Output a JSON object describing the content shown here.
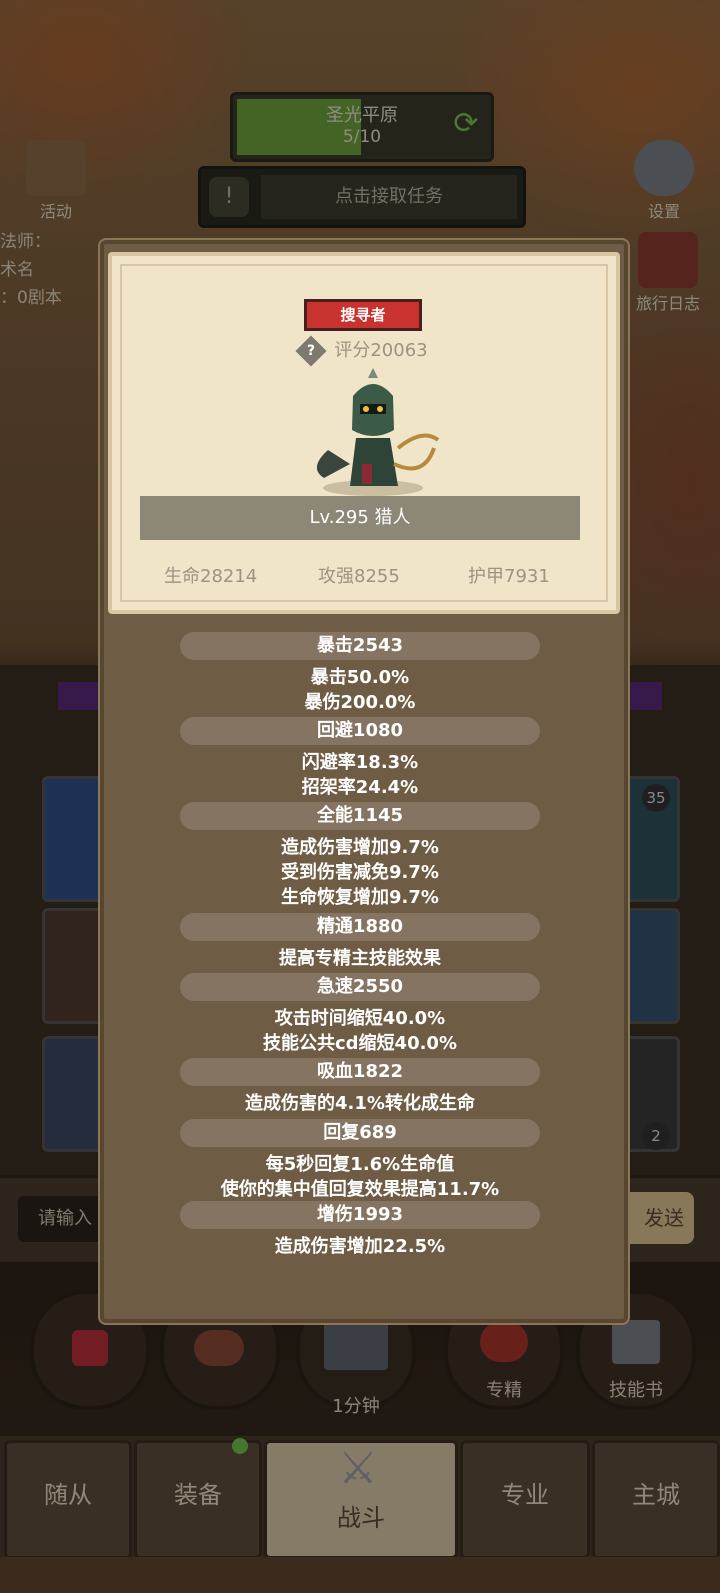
{
  "top": {
    "zone_name": "圣光平原",
    "zone_progress": "5/10",
    "progress_fraction": 0.5,
    "quest_button": "点击接取任务"
  },
  "side": {
    "events": "活动",
    "settings": "设置",
    "journal": "旅行日志",
    "left_partial": [
      "法师：",
      "术名",
      "：0剧本"
    ]
  },
  "popup": {
    "tag": "搜寻者",
    "score": "评分20063",
    "score_help_icon": "?",
    "level_class": "Lv.295 猎人",
    "hp": "生命28214",
    "atk": "攻强8255",
    "armor": "护甲7931",
    "stats": [
      {
        "title": "暴击2543",
        "lines": [
          "暴击50.0%",
          "暴伤200.0%"
        ]
      },
      {
        "title": "回避1080",
        "lines": [
          "闪避率18.3%",
          "招架率24.4%"
        ]
      },
      {
        "title": "全能1145",
        "lines": [
          "造成伤害增加9.7%",
          "受到伤害减免9.7%",
          "生命恢复增加9.7%"
        ]
      },
      {
        "title": "精通1880",
        "lines": [
          "提高专精主技能效果"
        ]
      },
      {
        "title": "急速2550",
        "lines": [
          "攻击时间缩短40.0%",
          "技能公共cd缩短40.0%"
        ]
      },
      {
        "title": "吸血1822",
        "lines": [
          "造成伤害的4.1%转化成生命"
        ]
      },
      {
        "title": "回复689",
        "lines": [
          "每5秒回复1.6%生命值",
          "使你的集中值回复效果提高11.7%"
        ]
      },
      {
        "title": "增伤1993",
        "lines": [
          "造成伤害增加22.5%"
        ]
      }
    ]
  },
  "chat": {
    "placeholder": "请输入",
    "send": "发送"
  },
  "badges": {
    "top_right": "35",
    "bottom_right": "2"
  },
  "actions": {
    "timer": "1分钟",
    "specialize": "专精",
    "skillbook": "技能书"
  },
  "nav": {
    "followers": "随从",
    "equipment": "装备",
    "battle": "战斗",
    "profession": "专业",
    "city": "主城"
  }
}
